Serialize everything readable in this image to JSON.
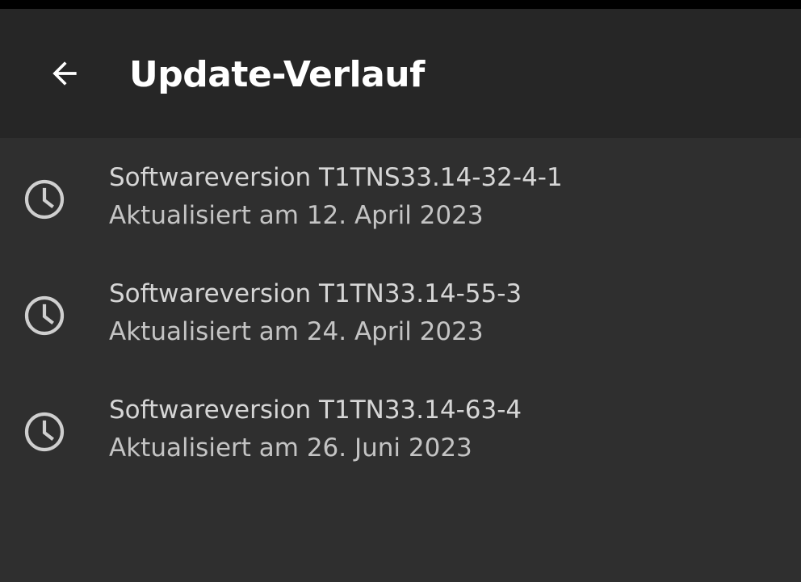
{
  "header": {
    "title": "Update-Verlauf",
    "back_icon": "arrow-back-icon"
  },
  "updates": [
    {
      "icon": "clock-icon",
      "version": "Softwareversion T1TNS33.14-32-4-1",
      "date": "Aktualisiert am 12. April 2023"
    },
    {
      "icon": "clock-icon",
      "version": "Softwareversion T1TN33.14-55-3",
      "date": "Aktualisiert am 24. April 2023"
    },
    {
      "icon": "clock-icon",
      "version": "Softwareversion T1TN33.14-63-4",
      "date": "Aktualisiert am 26. Juni 2023"
    }
  ],
  "colors": {
    "background": "#2f2f2f",
    "appbar": "#262626",
    "title_text": "#ffffff",
    "item_text": "#d6d6d6",
    "icon": "#cfcfcf"
  }
}
